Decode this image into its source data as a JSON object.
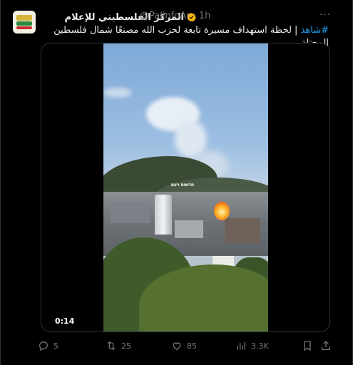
{
  "tweet": {
    "author_name": "المركز الفلسطيني للإعلام",
    "handle": "@PalinfoAr",
    "separator": "·",
    "time": "1h",
    "hashtag": "#شاهد",
    "text_after_hashtag": " | لحظة استهداف مسيرة تابعة لحزب الله مصنعًا شمال فلسطين المحتلة.",
    "media": {
      "duration": "0:14",
      "watermark": "חדשות רעם"
    },
    "actions": {
      "replies": "5",
      "reposts": "25",
      "likes": "85",
      "views": "3.3K"
    }
  },
  "icons": {
    "more": "more-icon",
    "verified": "verified-icon",
    "reply": "reply-icon",
    "repost": "repost-icon",
    "like": "like-icon",
    "views": "views-icon",
    "bookmark": "bookmark-icon",
    "share": "share-icon"
  },
  "colors": {
    "accent": "#1d9bf0",
    "verified": "#f5b512",
    "secondary_text": "#71767b",
    "background": "#000000"
  }
}
